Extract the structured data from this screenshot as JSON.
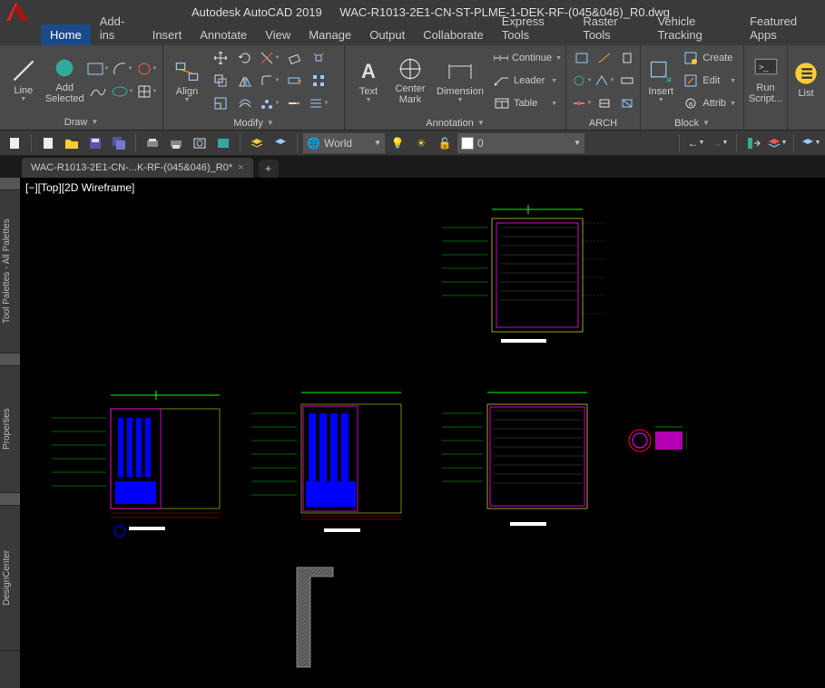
{
  "title": {
    "app": "Autodesk AutoCAD 2019",
    "file": "WAC-R1013-2E1-CN-ST-PLME-1-DEK-RF-(045&046)_R0.dwg"
  },
  "tabs": [
    "Home",
    "Add-ins",
    "Insert",
    "Annotate",
    "View",
    "Manage",
    "Output",
    "Collaborate",
    "Express Tools",
    "Raster Tools",
    "Vehicle Tracking",
    "Featured Apps"
  ],
  "activeTab": "Home",
  "panels": {
    "draw": {
      "label": "Draw",
      "line": "Line",
      "add": "Add\nSelected"
    },
    "modify": {
      "label": "Modify",
      "align": "Align"
    },
    "annotation": {
      "label": "Annotation",
      "text": "Text",
      "center": "Center\nMark",
      "dimension": "Dimension",
      "continue": "Continue",
      "leader": "Leader",
      "table": "Table"
    },
    "arch": {
      "label": "ARCH"
    },
    "block": {
      "label": "Block",
      "insert": "Insert",
      "create": "Create",
      "edit": "Edit",
      "attrib": "Attrib"
    },
    "script": {
      "label": "",
      "run": "Run\nScript..."
    },
    "list": {
      "label": "",
      "list": "List"
    }
  },
  "qat": {
    "layer": "World",
    "colorValue": "0"
  },
  "fileTab": "WAC-R1013-2E1-CN-...K-RF-(045&046)_R0*",
  "viewport": "[−][Top][2D Wireframe]",
  "palettes": [
    "Tool Palettes - All Palettes",
    "Properties",
    "DesignCenter"
  ]
}
